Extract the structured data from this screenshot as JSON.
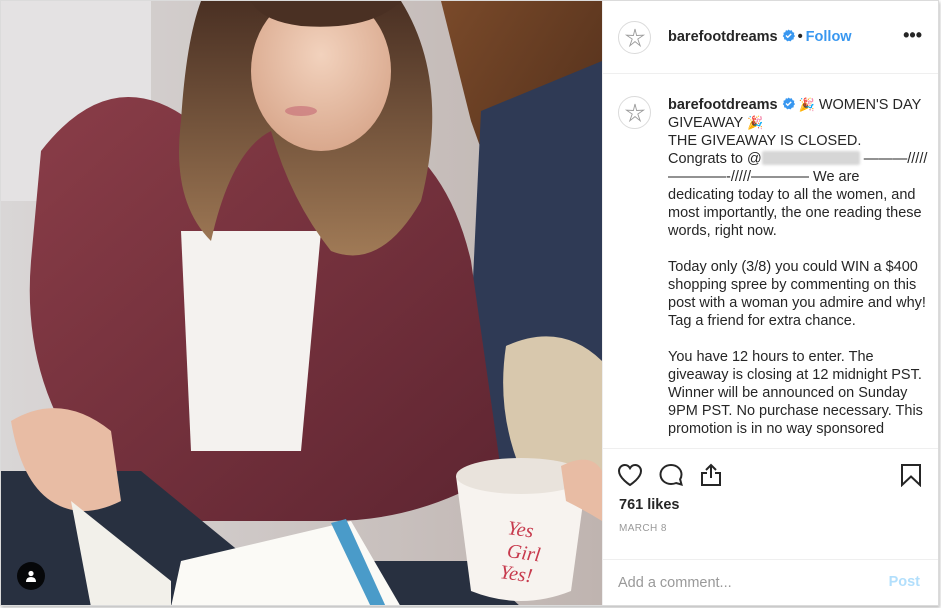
{
  "post": {
    "username": "barefootdreams",
    "dot": "•",
    "follow_label": "Follow",
    "more_label": "•••"
  },
  "caption": {
    "username": "barefootdreams",
    "emoji": "🎉",
    "line_title_1": "WOMEN'S DAY",
    "line_title_2": "GIVEAWAY",
    "closed": "THE GIVEAWAY IS CLOSED.",
    "congrats": "Congrats to @",
    "divider_tail": "———/////",
    "divider_line": "————-/////————",
    "p1_rest": "We are dedicating today to all the women, and most importantly, the one reading these words, right now.",
    "p2": "Today only (3/8) you could WIN a $400 shopping spree by commenting on this post with a woman you admire and why!",
    "p2b": "Tag a friend for extra chance.",
    "p3": "You have 12 hours to enter. The giveaway is closing at 12 midnight PST. Winner will be announced on Sunday 9PM PST. No purchase necessary. This promotion is in no way sponsored"
  },
  "actions": {
    "icons": [
      "heart-icon",
      "comment-icon",
      "share-icon",
      "bookmark-icon"
    ],
    "likes": "761 likes",
    "date": "MARCH 8"
  },
  "comment": {
    "placeholder": "Add a comment...",
    "post_label": "Post"
  },
  "colors": {
    "accent": "#3897f0",
    "post_disabled": "#b2dffc",
    "verified": "#3897f0",
    "text": "#262626",
    "muted": "#999999"
  }
}
